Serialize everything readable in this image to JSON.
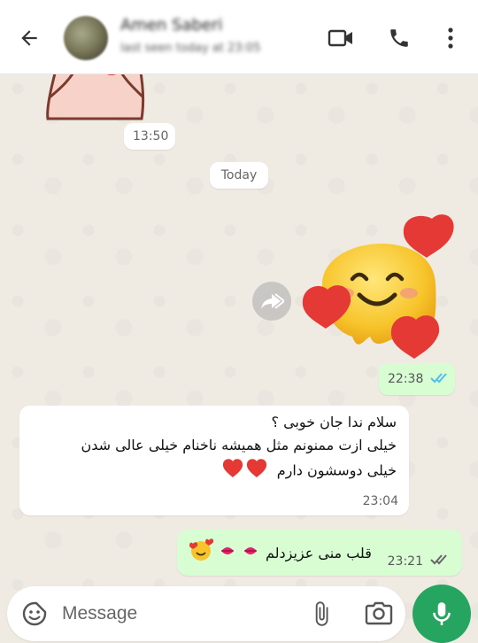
{
  "header": {
    "contact_name": "Amen Saberi",
    "status": "last seen today at 23:05"
  },
  "chat": {
    "time_marker": "13:50",
    "date_marker": "Today",
    "sticker_time": "22:38",
    "incoming": {
      "lines": [
        "سلام ندا جان خوبی ؟",
        "خیلی ازت ممنونم مثل همیشه ناخنام خیلی عالی شدن",
        "خیلی دوسشون دارم"
      ],
      "time": "23:04"
    },
    "outgoing": {
      "text": "قلب منی عزیزدلم",
      "time": "23:21"
    }
  },
  "composer": {
    "placeholder": "Message"
  },
  "colors": {
    "outgoing_bubble": "#d9fdd3",
    "tick_read": "#53bdeb",
    "mic_button": "#25a55f",
    "background": "#efeae2"
  }
}
